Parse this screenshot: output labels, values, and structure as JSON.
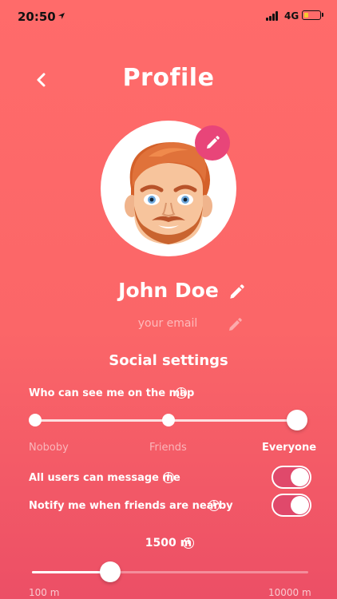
{
  "status_bar": {
    "time": "20:50",
    "network": "4G",
    "battery_level": 0.3
  },
  "header": {
    "title": "Profile",
    "back_icon": "chevron-left-icon"
  },
  "profile": {
    "name": "John Doe",
    "email_placeholder": "your email",
    "avatar_icon": "bitmoji-avatar",
    "edit_icon": "pencil-icon"
  },
  "social": {
    "title": "Social settings",
    "map_visibility": {
      "label": "Who can see me on the map",
      "options": [
        "Noboby",
        "Friends",
        "Everyone"
      ],
      "selected": "Everyone"
    },
    "messaging": {
      "label": "All users can message me",
      "enabled": true
    },
    "nearby_notify": {
      "label": "Notify me when friends are nearby",
      "enabled": true
    }
  },
  "distance": {
    "value_label": "1500 m",
    "min_label": "100 m",
    "max_label": "10000 m",
    "min": 100,
    "max": 10000,
    "value": 1500
  },
  "colors": {
    "accent": "#e84579",
    "toggle_on": "#e0496b",
    "battery": "#f5c92f"
  }
}
